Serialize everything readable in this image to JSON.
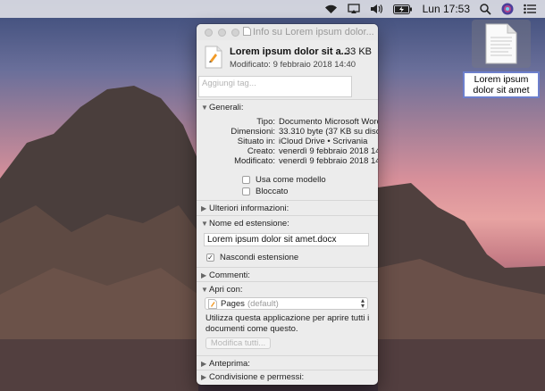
{
  "menubar": {
    "clock": "Lun 17:53",
    "icons": [
      "wifi-icon",
      "airplay-icon",
      "volume-icon",
      "battery-icon",
      "search-icon",
      "siri-icon",
      "notification-center-icon"
    ]
  },
  "desktop_file": {
    "label": "Lorem ipsum dolor sit amet"
  },
  "info_window": {
    "title": "Info su Lorem ipsum dolor...",
    "file_name": "Lorem ipsum dolor sit a...",
    "file_size": "33 KB",
    "modified": "Modificato: 9 febbraio 2018 14:40",
    "tags_placeholder": "Aggiungi tag...",
    "general": {
      "header": "Generali:",
      "rows": [
        {
          "key": "Tipo:",
          "value": "Documento Microsoft Word"
        },
        {
          "key": "Dimensioni:",
          "value": "33.310 byte (37 KB su disco)"
        },
        {
          "key": "Situato in:",
          "value": "iCloud Drive • Scrivania"
        },
        {
          "key": "Creato:",
          "value": "venerdì 9 febbraio 2018 14:40"
        },
        {
          "key": "Modificato:",
          "value": "venerdì 9 febbraio 2018 14:40"
        }
      ],
      "use_as_template": "Usa come modello",
      "locked": "Bloccato"
    },
    "more_info_header": "Ulteriori informazioni:",
    "name_ext": {
      "header": "Nome ed estensione:",
      "name_value": "Lorem ipsum dolor sit amet.docx",
      "hide_extension": "Nascondi estensione",
      "hide_extension_checked": true
    },
    "comments_header": "Commenti:",
    "open_with": {
      "header": "Apri con:",
      "app": "Pages",
      "app_default": "(default)",
      "description": "Utilizza questa applicazione per aprire tutti i documenti come questo.",
      "change_all": "Modifica tutti..."
    },
    "preview_header": "Anteprima:",
    "sharing_header": "Condivisione e permessi:"
  }
}
